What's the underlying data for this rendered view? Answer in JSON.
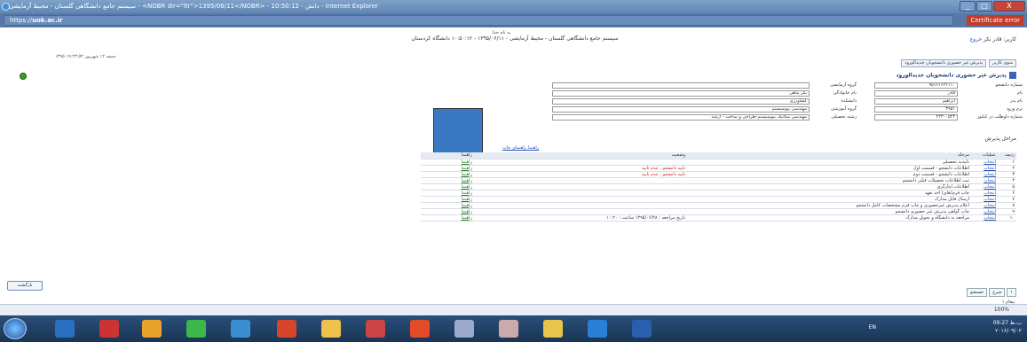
{
  "window": {
    "title": "سیستم جامع دانشگاهی گلستان - محیط آزمایشی - <NOBR dir=\"ltr\">1395/06/11</NOBR> - 10:50:12 - دانش - Internet Explorer",
    "btn_close": "X",
    "btn_min": "_",
    "btn_max": "□"
  },
  "address_bar": {
    "protocol": "https://",
    "domain": "uok.ac.ir",
    "cert_label": "Certificate error"
  },
  "header": {
    "sub": "به نام خدا",
    "main": "سیستم جامع دانشگاهی گلستان - محیط آزمایشی - ۱۳۹۵/۰۶/۱۱ - ۱۰:۵۰:۱۲    دانشگاه کردستان",
    "user": "کاربر: قادر بکر",
    "user_link": "خروج",
    "date": "۱۳۹۵ جمعه ۱۲ شهریور ۱۹:۲۳:۵۲"
  },
  "crumb": [
    "منوی کاربر",
    "پذیرش غیر حضوری دانشجویان جدیدالورود"
  ],
  "section_title": "پذیرش غیر حضوری دانشجویان جدیدالورود",
  "form": {
    "r1_l1": "شماره دانشجو",
    "r1_v1": "۹۵۱۶۱۶۲۶۱۱۰",
    "r1_l2": "گروه آزمایشی",
    "r1_v2": "",
    "r2_l1": "نام",
    "r2_v1": "قادر",
    "r2_l2": "نام خانوادگی",
    "r2_v2": "بکر پناهی",
    "r3_l1": "نام پدر",
    "r3_v1": "ابراهیم",
    "r3_l2": "دانشکده",
    "r3_v2": "کشاورزی",
    "r4_l1": "ترم ورود",
    "r4_v1": "۳۹۵۱",
    "r4_l2": "گروه آموزشی",
    "r4_v2": "مهندسی بیوسیستم",
    "r5_l1": "شماره داوطلب در کنکور",
    "r5_v1": "۲۲۳۰۰۵۲۳",
    "r5_l2": "رشته تحصیلی",
    "r5_v2": "مهندسی مکانیک بیوسیستم-طراحی و ساخت - ارشد"
  },
  "stages_label": "مراحل پذیرش",
  "help_links": "راهنما    راهنمای چاپ",
  "table": {
    "headers": [
      "ردیف",
      "عملیات",
      "مرحله",
      "وضعیت",
      "راهنما"
    ],
    "rows": [
      {
        "no": "۱",
        "act": "انتخاب",
        "stage": "تاییدیه تحصیلی",
        "status": "",
        "help": "راهنما"
      },
      {
        "no": "۲",
        "act": "انتخاب",
        "stage": "اطلاعات دانشجو - قسمت اول",
        "status": "تایید دانشجو : عدم تایید",
        "help": "راهنما"
      },
      {
        "no": "۳",
        "act": "انتخاب",
        "stage": "اطلاعات دانشجو - قسمت دوم",
        "status": "تایید دانشجو : عدم تایید",
        "help": "راهنما"
      },
      {
        "no": "۴",
        "act": "انتخاب",
        "stage": "ثبت اطلاعات تحصیلات قبلی دانشجو",
        "status": "",
        "help": "راهنما"
      },
      {
        "no": "۵",
        "act": "انتخاب",
        "stage": "اطلاعات ایثارگری",
        "status": "",
        "help": "راهنما"
      },
      {
        "no": "۶",
        "act": "انتخاب",
        "stage": "چاپ فرم(های) اخذ تعهد",
        "status": "",
        "help": "راهنما"
      },
      {
        "no": "۷",
        "act": "انتخاب",
        "stage": "ارسال فایل مدارک",
        "status": "",
        "help": "راهنما"
      },
      {
        "no": "۸",
        "act": "انتخاب",
        "stage": "اعلام پذیرش غیرحضوری و چاپ فرم مشخصات کامل دانشجو",
        "status": "",
        "help": "راهنما"
      },
      {
        "no": "۹",
        "act": "انتخاب",
        "stage": "چاپ گواهی پذیرش غیر حضوری دانشجو",
        "status": "",
        "help": "راهنما"
      },
      {
        "no": "۱۰",
        "act": "انتخاب",
        "stage": "مراجعه به دانشگاه و تحویل مدارک",
        "status": "تاریخ مراجعه : ۱۳۹۵/۰۶/۲۸ ساعت : ۱۰:۲۰",
        "help": "راهنما"
      }
    ]
  },
  "back_label": "بازگشت",
  "pager": {
    "p1": "۱",
    "p2": "شرح",
    "p3": "جستجو"
  },
  "messages": "۱ پیغام",
  "zoom": "100%",
  "tray": {
    "lang": "EN",
    "time": "09:27 ب.ظ",
    "date": "۲۰۱۶/۰۹/۰۲"
  }
}
